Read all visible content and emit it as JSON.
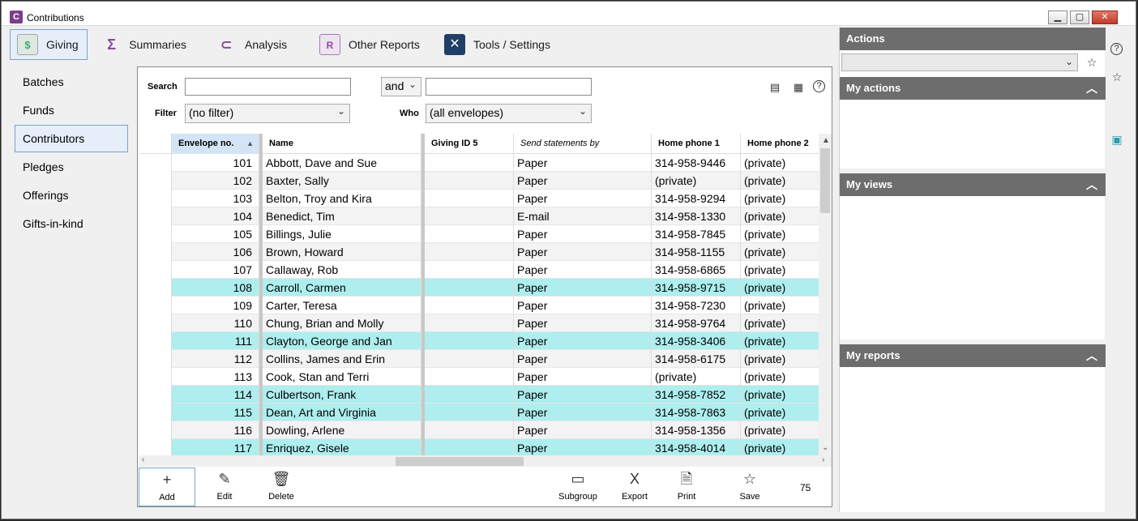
{
  "window": {
    "title": "Contributions",
    "app_icon_text": "C"
  },
  "tabs": [
    {
      "label": "Giving",
      "icon": "giving-icon"
    },
    {
      "label": "Summaries",
      "icon": "summaries-icon"
    },
    {
      "label": "Analysis",
      "icon": "analysis-icon"
    },
    {
      "label": "Other Reports",
      "icon": "reports-icon"
    },
    {
      "label": "Tools / Settings",
      "icon": "tools-icon"
    }
  ],
  "leftnav": [
    "Batches",
    "Funds",
    "Contributors",
    "Pledges",
    "Offerings",
    "Gifts-in-kind"
  ],
  "filters": {
    "search_label": "Search",
    "search_value": "",
    "conjunction": "and",
    "search2_value": "",
    "filter_label": "Filter",
    "filter_value": "(no filter)",
    "who_label": "Who",
    "who_value": "(all envelopes)"
  },
  "grid": {
    "columns": [
      "Envelope no.",
      "Name",
      "Giving ID 5",
      "Send statements by",
      "Home phone 1",
      "Home phone 2"
    ],
    "rows": [
      {
        "env": "101",
        "name": "Abbott, Dave and Sue",
        "gid": "",
        "send": "Paper",
        "p1": "314-958-9446",
        "p2": "(private)",
        "hl": false
      },
      {
        "env": "102",
        "name": "Baxter, Sally",
        "gid": "",
        "send": "Paper",
        "p1": "(private)",
        "p2": "(private)",
        "hl": false
      },
      {
        "env": "103",
        "name": "Belton, Troy and Kira",
        "gid": "",
        "send": "Paper",
        "p1": "314-958-9294",
        "p2": "(private)",
        "hl": false
      },
      {
        "env": "104",
        "name": "Benedict, Tim",
        "gid": "",
        "send": "E-mail",
        "p1": "314-958-1330",
        "p2": "(private)",
        "hl": false
      },
      {
        "env": "105",
        "name": "Billings, Julie",
        "gid": "",
        "send": "Paper",
        "p1": "314-958-7845",
        "p2": "(private)",
        "hl": false
      },
      {
        "env": "106",
        "name": "Brown, Howard",
        "gid": "",
        "send": "Paper",
        "p1": "314-958-1155",
        "p2": "(private)",
        "hl": false
      },
      {
        "env": "107",
        "name": "Callaway, Rob",
        "gid": "",
        "send": "Paper",
        "p1": "314-958-6865",
        "p2": "(private)",
        "hl": false
      },
      {
        "env": "108",
        "name": "Carroll, Carmen",
        "gid": "",
        "send": "Paper",
        "p1": "314-958-9715",
        "p2": "(private)",
        "hl": true
      },
      {
        "env": "109",
        "name": "Carter, Teresa",
        "gid": "",
        "send": "Paper",
        "p1": "314-958-7230",
        "p2": "(private)",
        "hl": false
      },
      {
        "env": "110",
        "name": "Chung, Brian and Molly",
        "gid": "",
        "send": "Paper",
        "p1": "314-958-9764",
        "p2": "(private)",
        "hl": false
      },
      {
        "env": "111",
        "name": "Clayton, George and Jan",
        "gid": "",
        "send": "Paper",
        "p1": "314-958-3406",
        "p2": "(private)",
        "hl": true
      },
      {
        "env": "112",
        "name": "Collins, James and Erin",
        "gid": "",
        "send": "Paper",
        "p1": "314-958-6175",
        "p2": "(private)",
        "hl": false
      },
      {
        "env": "113",
        "name": "Cook, Stan and Terri",
        "gid": "",
        "send": "Paper",
        "p1": "(private)",
        "p2": "(private)",
        "hl": false
      },
      {
        "env": "114",
        "name": "Culbertson, Frank",
        "gid": "",
        "send": "Paper",
        "p1": "314-958-7852",
        "p2": "(private)",
        "hl": true
      },
      {
        "env": "115",
        "name": "Dean, Art and Virginia",
        "gid": "",
        "send": "Paper",
        "p1": "314-958-7863",
        "p2": "(private)",
        "hl": true
      },
      {
        "env": "116",
        "name": "Dowling, Arlene",
        "gid": "",
        "send": "Paper",
        "p1": "314-958-1356",
        "p2": "(private)",
        "hl": false
      },
      {
        "env": "117",
        "name": "Enriquez, Gisele",
        "gid": "",
        "send": "Paper",
        "p1": "314-958-4014",
        "p2": "(private)",
        "hl": true
      }
    ]
  },
  "toolbar": {
    "add": "Add",
    "edit": "Edit",
    "delete": "Delete",
    "subgroup": "Subgroup",
    "export": "Export",
    "print": "Print",
    "save": "Save",
    "count": "75"
  },
  "rightpanel": {
    "actions_title": "Actions",
    "actions_value": "",
    "my_actions": "My actions",
    "my_views": "My views",
    "my_reports": "My reports"
  }
}
